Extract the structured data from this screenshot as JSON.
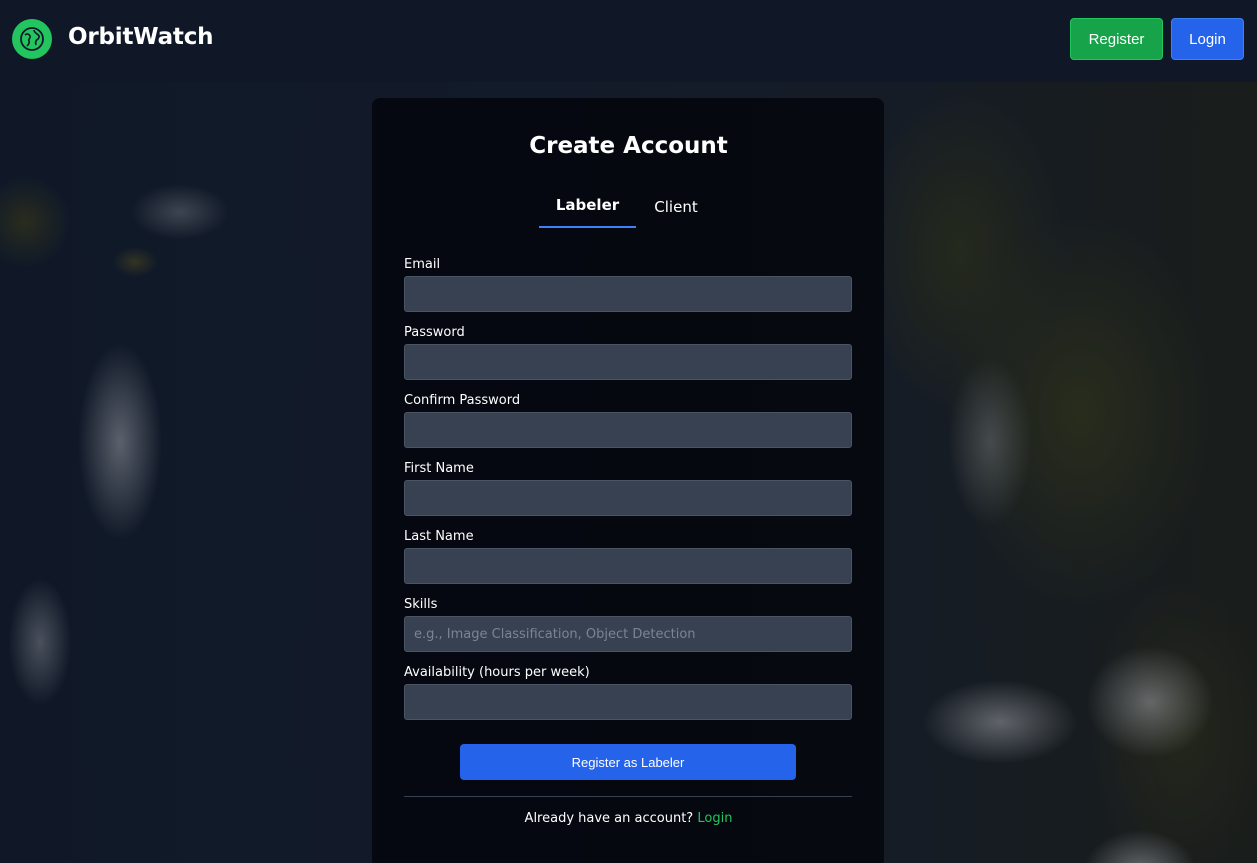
{
  "header": {
    "brand": "OrbitWatch",
    "logo_icon": "globe-icon",
    "register_label": "Register",
    "login_label": "Login"
  },
  "card": {
    "title": "Create Account",
    "tabs": [
      {
        "label": "Labeler",
        "active": true
      },
      {
        "label": "Client",
        "active": false
      }
    ],
    "fields": {
      "email": {
        "label": "Email",
        "value": "",
        "placeholder": ""
      },
      "password": {
        "label": "Password",
        "value": "",
        "placeholder": ""
      },
      "confirm_password": {
        "label": "Confirm Password",
        "value": "",
        "placeholder": ""
      },
      "first_name": {
        "label": "First Name",
        "value": "",
        "placeholder": ""
      },
      "last_name": {
        "label": "Last Name",
        "value": "",
        "placeholder": ""
      },
      "skills": {
        "label": "Skills",
        "value": "",
        "placeholder": "e.g., Image Classification, Object Detection"
      },
      "availability": {
        "label": "Availability (hours per week)",
        "value": "",
        "placeholder": ""
      }
    },
    "submit_label": "Register as Labeler",
    "footer_text": "Already have an account?",
    "footer_link": "Login"
  },
  "colors": {
    "header_bg": "#101828",
    "brand_green": "#22c55e",
    "register_green": "#16a34a",
    "primary_blue": "#2563eb",
    "input_bg": "#374151"
  }
}
